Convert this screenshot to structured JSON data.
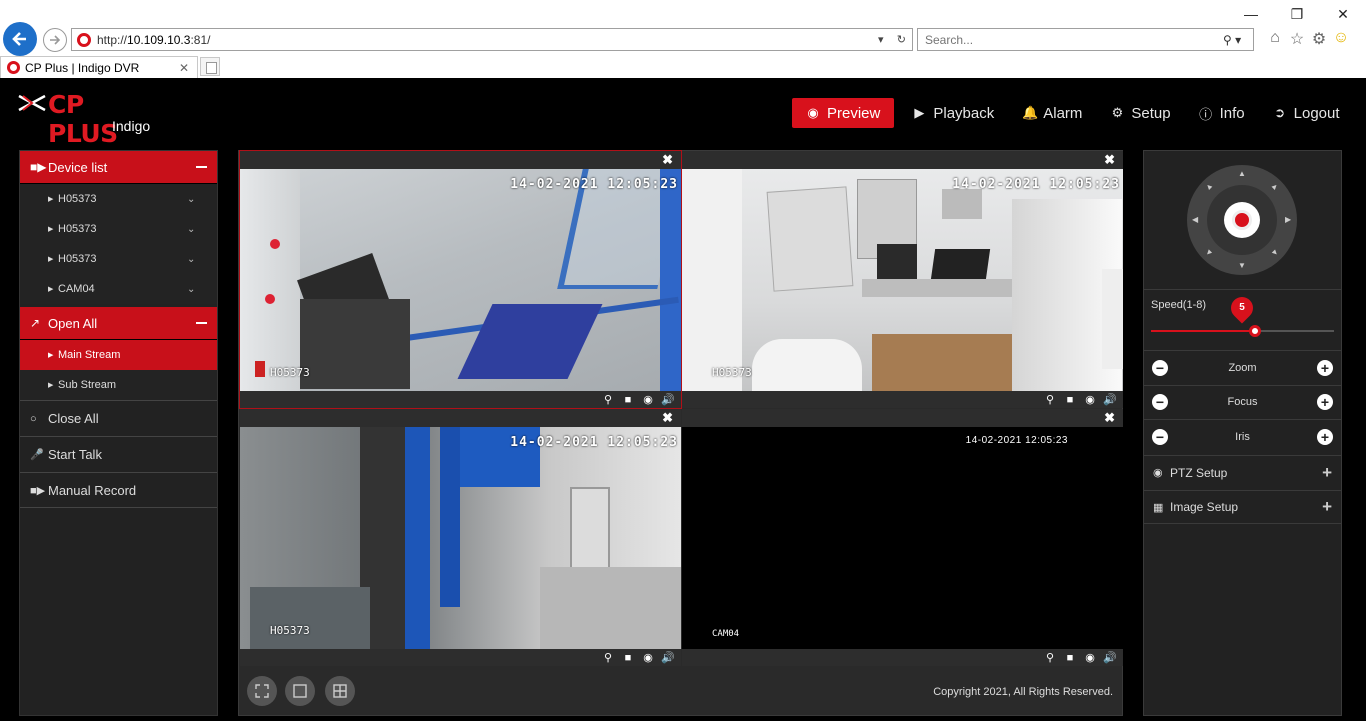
{
  "browser": {
    "url_prefix": "http://",
    "url_host": "10.109.10.3",
    "url_port": ":81/",
    "search_placeholder": "Search...",
    "tab_title": "CP Plus | Indigo DVR"
  },
  "brand": {
    "name": "CP PLUS",
    "product": "Indigo"
  },
  "nav": {
    "preview": "Preview",
    "playback": "Playback",
    "alarm": "Alarm",
    "setup": "Setup",
    "info": "Info",
    "logout": "Logout"
  },
  "left": {
    "device_list": "Device list",
    "devices": [
      "H05373",
      "H05373",
      "H05373",
      "CAM04"
    ],
    "open_all": "Open All",
    "main_stream": "Main Stream",
    "sub_stream": "Sub Stream",
    "close_all": "Close All",
    "start_talk": "Start Talk",
    "manual_record": "Manual Record"
  },
  "video": {
    "cells": [
      {
        "timestamp": "14-02-2021 12:05:23",
        "name": "H05373"
      },
      {
        "timestamp": "14-02-2021 12:05:23",
        "name": "H05373"
      },
      {
        "timestamp": "14-02-2021 12:05:23",
        "name": "H05373"
      },
      {
        "timestamp": "14-02-2021 12:05:23",
        "name": "CAM04"
      }
    ],
    "copyright": "Copyright 2021, All Rights Reserved."
  },
  "ptz": {
    "speed_label": "Speed(1-8)",
    "speed_value": "5",
    "speed_fraction": 0.57,
    "zoom": "Zoom",
    "focus": "Focus",
    "iris": "Iris",
    "ptz_setup": "PTZ Setup",
    "image_setup": "Image Setup"
  },
  "colors": {
    "accent": "#d8111c",
    "panel": "#222222",
    "background": "#000000"
  }
}
